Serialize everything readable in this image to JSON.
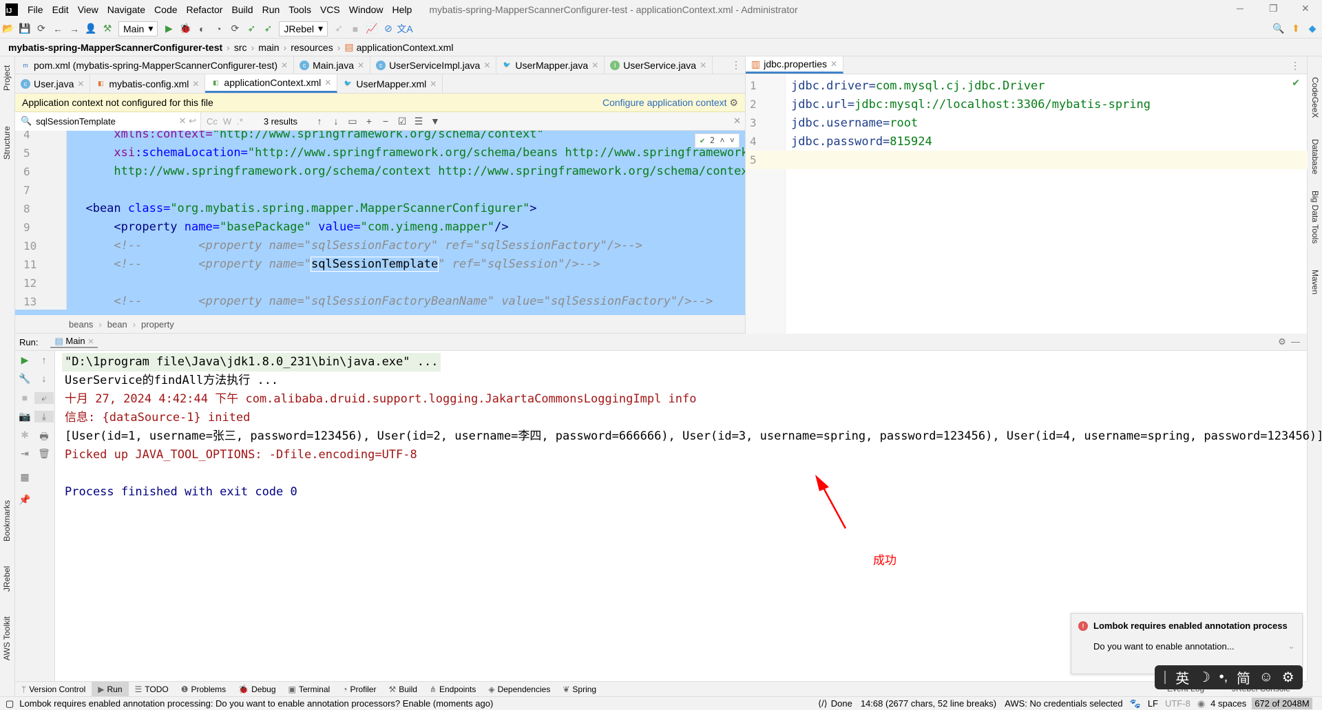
{
  "window": {
    "title": "mybatis-spring-MapperScannerConfigurer-test - applicationContext.xml - Administrator",
    "logo": "IJ"
  },
  "menu": [
    "File",
    "Edit",
    "View",
    "Navigate",
    "Code",
    "Refactor",
    "Build",
    "Run",
    "Tools",
    "VCS",
    "Window",
    "Help"
  ],
  "toolbar": {
    "run_config": "Main",
    "jrebel": "JRebel"
  },
  "breadcrumb": {
    "project": "mybatis-spring-MapperScannerConfigurer-test",
    "parts": [
      "src",
      "main",
      "resources",
      "applicationContext.xml"
    ]
  },
  "left_strip": [
    "Project",
    "Structure",
    "Bookmarks",
    "JRebel",
    "AWS Toolkit"
  ],
  "right_strip": [
    "CodeGeeX",
    "Database",
    "Big Data Tools",
    "Maven"
  ],
  "editor_tabs_row1": [
    {
      "label": "pom.xml (mybatis-spring-MapperScannerConfigurer-test)",
      "icon": "maven-icon"
    },
    {
      "label": "Main.java",
      "icon": "class-icon"
    },
    {
      "label": "UserServiceImpl.java",
      "icon": "class-icon"
    },
    {
      "label": "UserMapper.java",
      "icon": "mybatis-icon"
    },
    {
      "label": "UserService.java",
      "icon": "interface-icon"
    }
  ],
  "editor_tabs_row2": [
    {
      "label": "User.java",
      "icon": "class-icon"
    },
    {
      "label": "mybatis-config.xml",
      "icon": "xml-icon"
    },
    {
      "label": "applicationContext.xml",
      "icon": "spring-xml-icon",
      "active": true
    },
    {
      "label": "UserMapper.xml",
      "icon": "mybatis-icon"
    }
  ],
  "banner": {
    "text": "Application context not configured for this file",
    "action": "Configure application context"
  },
  "search": {
    "value": "sqlSessionTemplate",
    "results": "3 results",
    "opts": [
      "Cc",
      "W",
      ".*"
    ]
  },
  "match_count": "2",
  "code_lines": [
    {
      "n": "4",
      "segs": [
        {
          "k": "ns",
          "t": "      xmlns:context="
        },
        {
          "k": "val",
          "t": "\"http://www.springframework.org/schema/context\""
        }
      ]
    },
    {
      "n": "5",
      "segs": [
        {
          "k": "ns",
          "t": "      xsi"
        },
        {
          "k": "attr",
          "t": ":schemaLocation="
        },
        {
          "k": "val",
          "t": "\"http://www.springframework.org/schema/beans http://www.springframework.org/schema/beans/spring-beans.xsd"
        }
      ]
    },
    {
      "n": "6",
      "segs": [
        {
          "k": "val",
          "t": "      http://www.springframework.org/schema/context http://www.springframework.org/schema/context/spring-context.xsd\">"
        }
      ]
    },
    {
      "n": "7",
      "segs": []
    },
    {
      "n": "8",
      "segs": [
        {
          "k": "tag",
          "t": "  <bean "
        },
        {
          "k": "attr",
          "t": "class="
        },
        {
          "k": "val",
          "t": "\"org.mybatis.spring.mapper.MapperScannerConfigurer\""
        },
        {
          "k": "tag",
          "t": ">"
        }
      ]
    },
    {
      "n": "9",
      "segs": [
        {
          "k": "tag",
          "t": "      <property "
        },
        {
          "k": "attr",
          "t": "name="
        },
        {
          "k": "val",
          "t": "\"basePackage\" "
        },
        {
          "k": "attr",
          "t": "value="
        },
        {
          "k": "val",
          "t": "\"com.yimeng.mapper\""
        },
        {
          "k": "tag",
          "t": "/>"
        }
      ]
    },
    {
      "n": "10",
      "segs": [
        {
          "k": "cmt",
          "t": "      <!--        <property name=\"sqlSessionFactory\" ref=\"sqlSessionFactory\"/>-->"
        }
      ]
    },
    {
      "n": "11",
      "segs": [
        {
          "k": "cmt",
          "t": "      <!--        <property name=\""
        },
        {
          "k": "hl",
          "t": "sqlSessionTemplate"
        },
        {
          "k": "cmt",
          "t": "\" ref=\"sqlSession\"/>-->"
        }
      ]
    },
    {
      "n": "12",
      "segs": []
    },
    {
      "n": "13",
      "segs": [
        {
          "k": "cmt",
          "t": "      <!--        <property name=\"sqlSessionFactoryBeanName\" value=\"sqlSessionFactory\"/>-->"
        }
      ]
    }
  ],
  "xml_breadcrumb": [
    "beans",
    "bean",
    "property"
  ],
  "right_tab": "jdbc.properties",
  "properties": [
    {
      "n": "1",
      "key": "jdbc.driver=",
      "val": "com.mysql.cj.jdbc.Driver"
    },
    {
      "n": "2",
      "key": "jdbc.url=",
      "val": "jdbc:mysql://localhost:3306/mybatis-spring"
    },
    {
      "n": "3",
      "key": "jdbc.username=",
      "val": "root"
    },
    {
      "n": "4",
      "key": "jdbc.password=",
      "val": "815924"
    },
    {
      "n": "5",
      "key": "",
      "val": ""
    }
  ],
  "run": {
    "label": "Run:",
    "tab": "Main"
  },
  "console": [
    {
      "t": "\"D:\\1program file\\Java\\jdk1.8.0_231\\bin\\java.exe\" ...",
      "c": "#000000",
      "bg": "#e8f2e4"
    },
    {
      "t": "UserService的findAll方法执行 ...",
      "c": "#000000"
    },
    {
      "t": "十月 27, 2024 4:42:44 下午 com.alibaba.druid.support.logging.JakartaCommonsLoggingImpl info",
      "c": "#a31515"
    },
    {
      "t": "信息: {dataSource-1} inited",
      "c": "#a31515"
    },
    {
      "t": "[User(id=1, username=张三, password=123456), User(id=2, username=李四, password=666666), User(id=3, username=spring, password=123456), User(id=4, username=spring, password=123456)]",
      "c": "#000000"
    },
    {
      "t": "Picked up JAVA_TOOL_OPTIONS: -Dfile.encoding=UTF-8",
      "c": "#a31515"
    },
    {
      "t": "",
      "c": "#000000"
    },
    {
      "t": "Process finished with exit code 0",
      "c": "#000080"
    }
  ],
  "annotation": {
    "text": "成功",
    "color": "#ff0000"
  },
  "bottom_tabs": [
    "Version Control",
    "Run",
    "TODO",
    "Problems",
    "Debug",
    "Terminal",
    "Profiler",
    "Build",
    "Endpoints",
    "Dependencies",
    "Spring"
  ],
  "hidden_tabs": [
    "Event Log",
    "JRebel Console"
  ],
  "status": {
    "message": "Lombok requires enabled annotation processing: Do you want to enable annotation processors? Enable (moments ago)",
    "done": "Done",
    "position": "14:68 (2677 chars, 52 line breaks)",
    "aws": "AWS: No credentials selected",
    "line_sep": "LF",
    "encoding": "UTF-8",
    "indent": "4 spaces",
    "memory": "672 of 2048M"
  },
  "notification": {
    "title": "Lombok requires enabled annotation process",
    "body": "Do you want to enable annotation..."
  },
  "ime": [
    "英",
    "☽",
    "•,",
    "简",
    "☺",
    "⚙"
  ]
}
